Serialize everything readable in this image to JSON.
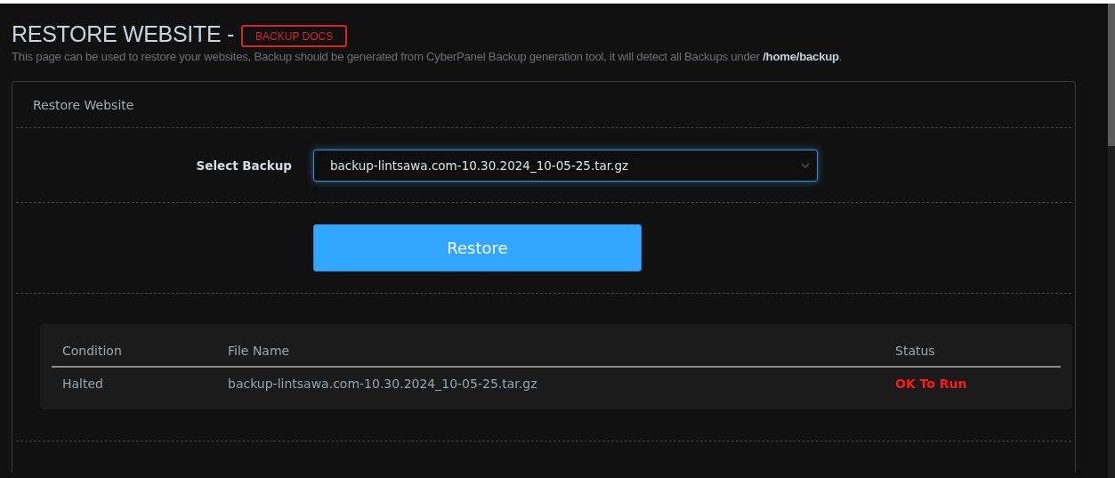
{
  "header": {
    "title": "RESTORE WEBSITE -",
    "docs_link": "BACKUP DOCS",
    "description": "This page can be used to restore your websites, Backup should be generated from CyberPanel Backup generation tool, it will detect all Backups under **/home/backup**."
  },
  "panel": {
    "title": "Restore Website",
    "select_backup": {
      "label": "Select Backup",
      "value": "backup-lintsawa.com-10.30.2024_10-05-25.tar.gz"
    },
    "restore_button": "Restore",
    "table": {
      "columns": [
        "Condition",
        "File Name",
        "Status"
      ],
      "rows": [
        {
          "condition": "Halted",
          "file_name": "backup-lintsawa.com-10.30.2024_10-05-25.tar.gz",
          "status": "OK To Run"
        }
      ]
    }
  }
}
